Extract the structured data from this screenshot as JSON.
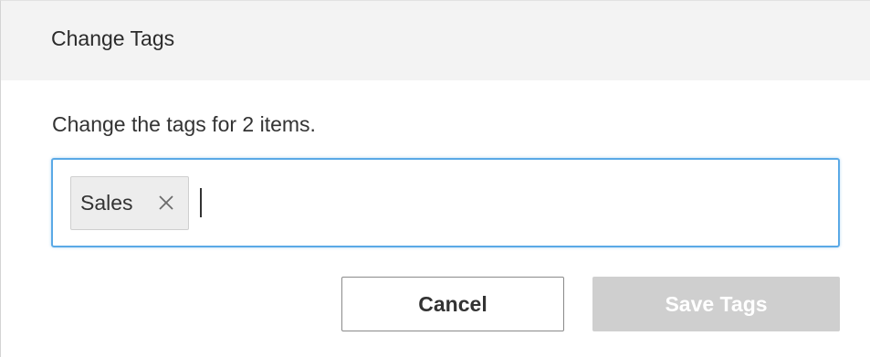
{
  "dialog": {
    "title": "Change Tags",
    "message": "Change the tags for 2 items.",
    "tags": [
      {
        "label": "Sales",
        "remove_icon": "close-icon"
      }
    ],
    "input_value": "",
    "buttons": {
      "cancel_label": "Cancel",
      "save_label": "Save Tags",
      "save_enabled": false
    }
  },
  "colors": {
    "header_bg": "#f3f3f3",
    "focus_border": "#5aa9e6",
    "tag_bg": "#ededed",
    "disabled_button_bg": "#cfcfcf"
  }
}
